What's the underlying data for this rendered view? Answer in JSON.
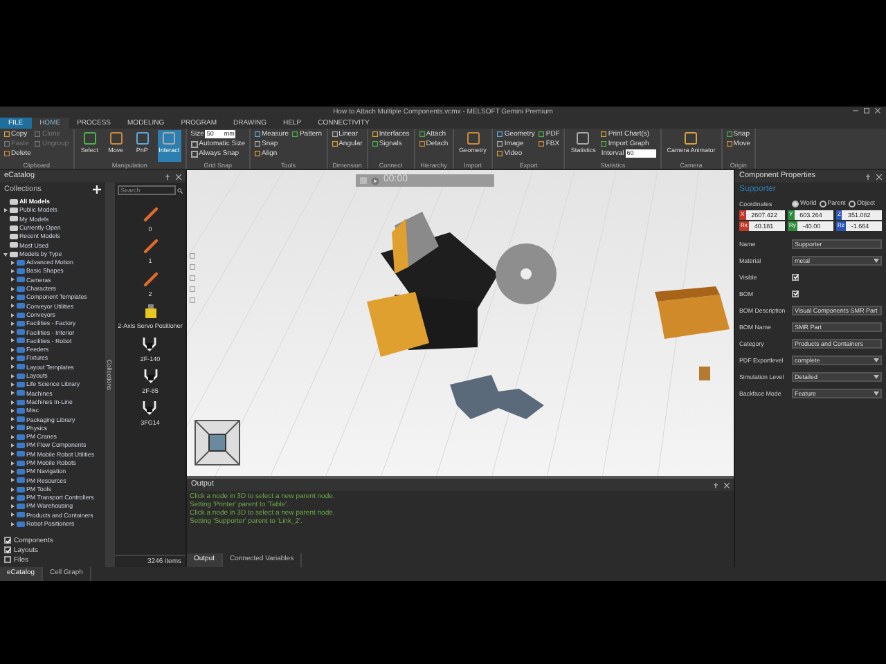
{
  "window": {
    "title": "How to Attach Multiple Components.vcmx - MELSOFT Gemini Premium"
  },
  "menu_tabs": [
    {
      "label": "FILE",
      "selected": false,
      "kind": "file"
    },
    {
      "label": "HOME",
      "selected": true,
      "kind": "tab"
    },
    {
      "label": "PROCESS",
      "selected": false,
      "kind": "tab"
    },
    {
      "label": "MODELING",
      "selected": false,
      "kind": "tab"
    },
    {
      "label": "PROGRAM",
      "selected": false,
      "kind": "tab"
    },
    {
      "label": "DRAWING",
      "selected": false,
      "kind": "tab"
    },
    {
      "label": "HELP",
      "selected": false,
      "kind": "tab"
    },
    {
      "label": "CONNECTIVITY",
      "selected": false,
      "kind": "tab"
    }
  ],
  "ribbon_groups": [
    {
      "label": "Clipboard",
      "items": [
        {
          "kind": "small",
          "label": "Copy",
          "disabled": false
        },
        {
          "kind": "small",
          "label": "Paste",
          "disabled": true
        },
        {
          "kind": "small",
          "label": "Delete",
          "disabled": false
        },
        {
          "kind": "small",
          "label": "Clone",
          "disabled": true
        },
        {
          "kind": "small",
          "label": "Ungroup",
          "disabled": true
        }
      ]
    },
    {
      "label": "Manipulation",
      "items": [
        {
          "kind": "large",
          "label": "Select",
          "selected": false
        },
        {
          "kind": "large",
          "label": "Move",
          "selected": false
        },
        {
          "kind": "large",
          "label": "PnP",
          "selected": false
        },
        {
          "kind": "large",
          "label": "Interact",
          "selected": true
        }
      ]
    },
    {
      "label": "Grid Snap",
      "items": [
        {
          "kind": "field",
          "label": "Size",
          "value": "50",
          "unit": "mm"
        },
        {
          "kind": "check",
          "label": "Automatic Size",
          "checked": false
        },
        {
          "kind": "check",
          "label": "Always Snap",
          "checked": false
        }
      ]
    },
    {
      "label": "Tools",
      "items": [
        {
          "kind": "small",
          "label": "Measure",
          "disabled": false
        },
        {
          "kind": "small",
          "label": "Snap",
          "disabled": false
        },
        {
          "kind": "small",
          "label": "Align",
          "disabled": false
        },
        {
          "kind": "small",
          "label": "Pattern",
          "disabled": false
        }
      ]
    },
    {
      "label": "Dimension",
      "items": [
        {
          "kind": "small",
          "label": "Linear",
          "disabled": false
        },
        {
          "kind": "small",
          "label": "Angular",
          "disabled": false
        }
      ]
    },
    {
      "label": "Connect",
      "items": [
        {
          "kind": "small",
          "label": "Interfaces",
          "disabled": false
        },
        {
          "kind": "small",
          "label": "Signals",
          "disabled": false
        }
      ]
    },
    {
      "label": "Hierarchy",
      "items": [
        {
          "kind": "small",
          "label": "Attach",
          "disabled": false
        },
        {
          "kind": "small",
          "label": "Detach",
          "disabled": false
        }
      ]
    },
    {
      "label": "Import",
      "items": [
        {
          "kind": "large",
          "label": "Geometry",
          "selected": false
        }
      ]
    },
    {
      "label": "Export",
      "items": [
        {
          "kind": "small",
          "label": "Geometry",
          "disabled": false
        },
        {
          "kind": "small",
          "label": "Image",
          "disabled": false
        },
        {
          "kind": "small",
          "label": "Video",
          "disabled": false
        },
        {
          "kind": "small",
          "label": "PDF",
          "disabled": false
        },
        {
          "kind": "small",
          "label": "FBX",
          "disabled": false
        }
      ]
    },
    {
      "label": "Statistics",
      "items": [
        {
          "kind": "large",
          "label": "Statistics",
          "selected": false
        },
        {
          "kind": "small",
          "label": "Print Chart(s)",
          "disabled": false
        },
        {
          "kind": "small",
          "label": "Import Graph",
          "disabled": false
        },
        {
          "kind": "field",
          "label": "Interval",
          "value": "60"
        }
      ]
    },
    {
      "label": "Camera",
      "items": [
        {
          "kind": "large",
          "label": "Camera Animator",
          "selected": false
        }
      ]
    },
    {
      "label": "Origin",
      "items": [
        {
          "kind": "small",
          "label": "Snap",
          "disabled": false
        },
        {
          "kind": "small",
          "label": "Move",
          "disabled": false
        }
      ]
    }
  ],
  "catalog": {
    "title": "eCatalog",
    "collections_label": "Collections",
    "search": {
      "placeholder": "Search"
    },
    "tree": [
      {
        "label": "All Models",
        "selected": true
      },
      {
        "label": "Public Models",
        "selected": false,
        "expanded": false
      },
      {
        "label": "My Models",
        "selected": false
      },
      {
        "label": "Currently Open",
        "selected": false
      },
      {
        "label": "Recent Models",
        "selected": false
      },
      {
        "label": "Most Used",
        "selected": false
      },
      {
        "label": "Models by Type",
        "selected": false,
        "expanded": true,
        "children": [
          {
            "label": "Advanced Motion",
            "selected": false,
            "expanded": false
          },
          {
            "label": "Basic Shapes",
            "selected": false,
            "expanded": false
          },
          {
            "label": "Cameras",
            "selected": false,
            "expanded": false
          },
          {
            "label": "Characters",
            "selected": false,
            "expanded": false
          },
          {
            "label": "Component Templates",
            "selected": false,
            "expanded": false
          },
          {
            "label": "Conveyor Utilities",
            "selected": false,
            "expanded": false
          },
          {
            "label": "Conveyors",
            "selected": false,
            "expanded": false
          },
          {
            "label": "Facilities - Factory",
            "selected": false,
            "expanded": false
          },
          {
            "label": "Facilities - Interior",
            "selected": false,
            "expanded": false
          },
          {
            "label": "Facilities - Robot",
            "selected": false,
            "expanded": false
          },
          {
            "label": "Feeders",
            "selected": false,
            "expanded": false
          },
          {
            "label": "Fixtures",
            "selected": false,
            "expanded": false
          },
          {
            "label": "Layout Templates",
            "selected": false,
            "expanded": false
          },
          {
            "label": "Layouts",
            "selected": false,
            "expanded": false
          },
          {
            "label": "Life Science Library",
            "selected": false,
            "expanded": false
          },
          {
            "label": "Machines",
            "selected": false,
            "expanded": false
          },
          {
            "label": "Machines In-Line",
            "selected": false,
            "expanded": false
          },
          {
            "label": "Misc",
            "selected": false,
            "expanded": false
          },
          {
            "label": "Packaging Library",
            "selected": false,
            "expanded": false
          },
          {
            "label": "Physics",
            "selected": false,
            "expanded": false
          },
          {
            "label": "PM Cranes",
            "selected": false,
            "expanded": false
          },
          {
            "label": "PM Flow Components",
            "selected": false,
            "expanded": false
          },
          {
            "label": "PM Mobile Robot Utilities",
            "selected": false,
            "expanded": false
          },
          {
            "label": "PM Mobile Robots",
            "selected": false,
            "expanded": false
          },
          {
            "label": "PM Navigation",
            "selected": false,
            "expanded": false
          },
          {
            "label": "PM Resources",
            "selected": false,
            "expanded": false
          },
          {
            "label": "PM Tools",
            "selected": false,
            "expanded": false
          },
          {
            "label": "PM Transport Controllers",
            "selected": false,
            "expanded": false
          },
          {
            "label": "PM Warehousing",
            "selected": false,
            "expanded": false
          },
          {
            "label": "Products and Containers",
            "selected": false,
            "expanded": false
          },
          {
            "label": "Robot Positioners",
            "selected": false,
            "expanded": false
          }
        ]
      }
    ],
    "filters": [
      {
        "label": "Components",
        "checked": true
      },
      {
        "label": "Layouts",
        "checked": true
      },
      {
        "label": "Files",
        "checked": false
      }
    ],
    "side_tab": "Collections",
    "items": [
      {
        "label": "0",
        "kind": "digit"
      },
      {
        "label": "1",
        "kind": "digit"
      },
      {
        "label": "2",
        "kind": "digit"
      },
      {
        "label": "2-Axis Servo Positioner",
        "kind": "positioner"
      },
      {
        "label": "2F-140",
        "kind": "gripper"
      },
      {
        "label": "2F-85",
        "kind": "gripper"
      },
      {
        "label": "3FG14",
        "kind": "gripper"
      }
    ],
    "count": "3246 items"
  },
  "viewport": {
    "time": "00:00"
  },
  "output": {
    "title": "Output",
    "lines": [
      "Click a node in 3D to select a new parent node.",
      "Setting 'Printer' parent to 'Table'.",
      "Click a node in 3D to select a new parent node.",
      "Setting 'Supporter' parent to 'Link_2'."
    ],
    "tabs": [
      {
        "label": "Output",
        "selected": true
      },
      {
        "label": "Connected Variables",
        "selected": false
      }
    ]
  },
  "properties": {
    "title": "Component Properties",
    "component": "Supporter",
    "coordinates_label": "Coordinates",
    "frames": [
      {
        "label": "World",
        "selected": true
      },
      {
        "label": "Parent",
        "selected": false
      },
      {
        "label": "Object",
        "selected": false
      }
    ],
    "coords": [
      {
        "axis": "X",
        "value": "2607.422",
        "color": "#c0392b"
      },
      {
        "axis": "Y",
        "value": "603.264",
        "color": "#2e8b3a"
      },
      {
        "axis": "Z",
        "value": "351.082",
        "color": "#2a55b8"
      },
      {
        "axis": "Rx",
        "value": "40.181",
        "color": "#c0392b"
      },
      {
        "axis": "Ry",
        "value": "-40.00",
        "color": "#2e8b3a"
      },
      {
        "axis": "Rz",
        "value": "-1.664",
        "color": "#2a55b8"
      }
    ],
    "fields": [
      {
        "kind": "text",
        "label": "Name",
        "value": "Supporter"
      },
      {
        "kind": "dropdown",
        "label": "Material",
        "value": "metal"
      },
      {
        "kind": "check",
        "label": "Visible",
        "checked": true
      },
      {
        "kind": "check",
        "label": "BOM",
        "checked": true
      },
      {
        "kind": "text",
        "label": "BOM Description",
        "value": "Visual Components SMR Part"
      },
      {
        "kind": "text",
        "label": "BOM Name",
        "value": "SMR Part"
      },
      {
        "kind": "text",
        "label": "Category",
        "value": "Products and Containers"
      },
      {
        "kind": "dropdown",
        "label": "PDF Exportlevel",
        "value": "complete"
      },
      {
        "kind": "dropdown",
        "label": "Simulation Level",
        "value": "Detailed"
      },
      {
        "kind": "dropdown",
        "label": "Backface Mode",
        "value": "Feature"
      }
    ]
  },
  "bottom_tabs": [
    {
      "label": "eCatalog",
      "selected": true
    },
    {
      "label": "Cell Graph",
      "selected": false
    }
  ]
}
